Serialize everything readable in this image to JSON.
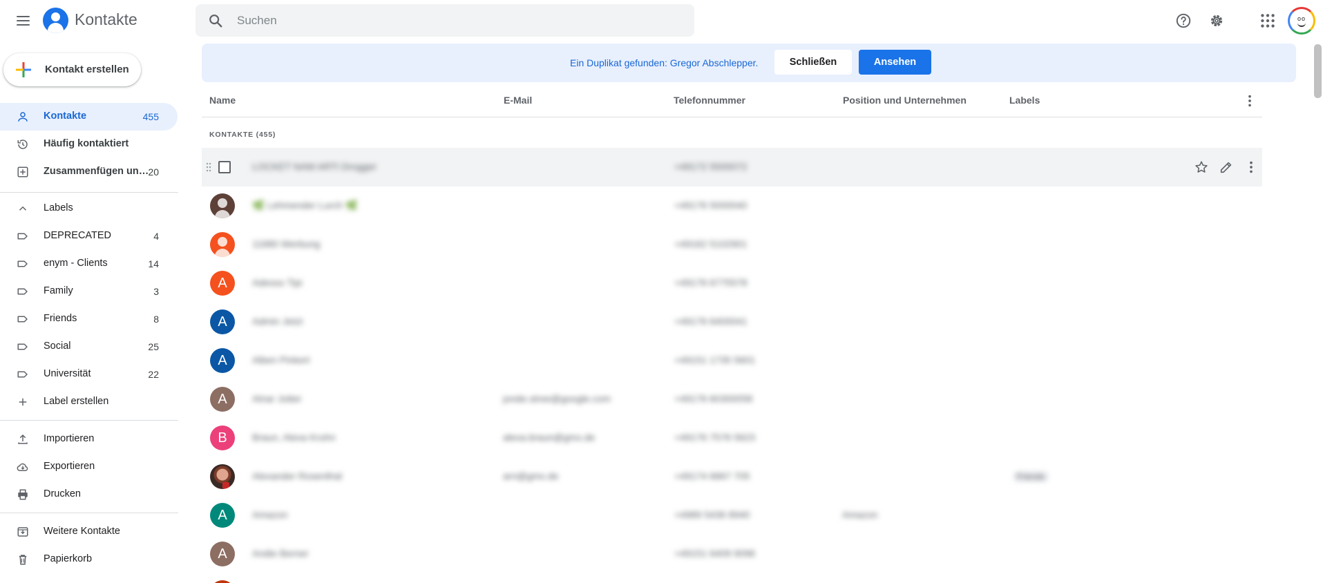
{
  "header": {
    "title": "Kontakte",
    "search_placeholder": "Suchen"
  },
  "sidebar": {
    "create_label": "Kontakt erstellen",
    "nav": [
      {
        "label": "Kontakte",
        "count": "455"
      },
      {
        "label": "Häufig kontaktiert",
        "count": ""
      },
      {
        "label": "Zusammenfügen un…",
        "count": "20"
      }
    ],
    "labels_heading": "Labels",
    "labels": [
      {
        "label": "DEPRECATED",
        "count": "4"
      },
      {
        "label": "enym - Clients",
        "count": "14"
      },
      {
        "label": "Family",
        "count": "3"
      },
      {
        "label": "Friends",
        "count": "8"
      },
      {
        "label": "Social",
        "count": "25"
      },
      {
        "label": "Universität",
        "count": "22"
      }
    ],
    "create_label_item": "Label erstellen",
    "tools": [
      "Importieren",
      "Exportieren",
      "Drucken"
    ],
    "bottom": [
      "Weitere Kontakte",
      "Papierkorb"
    ]
  },
  "banner": {
    "message": "Ein Duplikat gefunden: Gregor Abschlepper.",
    "close_label": "Schließen",
    "view_label": "Ansehen"
  },
  "table": {
    "columns": [
      "Name",
      "E-Mail",
      "Telefonnummer",
      "Position und Unternehmen",
      "Labels"
    ],
    "section_label": "KONTAKTE (455)",
    "rows": [
      {
        "avatar": "checkbox",
        "initial": "",
        "color": "",
        "name": "LOCKET NAM ARTI Drogger",
        "email": "",
        "phone": "+49172 5500072",
        "company": "",
        "label": ""
      },
      {
        "avatar": "person",
        "initial": "",
        "color": "#5d4037",
        "name": "🌿 Lehmender Lurch 🌿",
        "email": "",
        "phone": "+49176 5000040",
        "company": "",
        "label": ""
      },
      {
        "avatar": "person",
        "initial": "",
        "color": "#f4511e",
        "name": "11880 Werbung",
        "email": "",
        "phone": "+49162 5102901",
        "company": "",
        "label": ""
      },
      {
        "avatar": "letter",
        "initial": "A",
        "color": "#f4511e",
        "name": "Adesso Tipi",
        "email": "",
        "phone": "+49176 6775578",
        "company": "",
        "label": ""
      },
      {
        "avatar": "letter",
        "initial": "A",
        "color": "#0b57a6",
        "name": "Admin Jetzt",
        "email": "",
        "phone": "+49176 6400041",
        "company": "",
        "label": ""
      },
      {
        "avatar": "letter",
        "initial": "A",
        "color": "#0b57a6",
        "name": "Alben Pinkert",
        "email": "",
        "phone": "+49151 1735 5601",
        "company": "",
        "label": ""
      },
      {
        "avatar": "letter",
        "initial": "A",
        "color": "#8d6e63",
        "name": "Alnar Jotter",
        "email": "jonde.stree@google.com",
        "phone": "+49176 60300058",
        "company": "",
        "label": ""
      },
      {
        "avatar": "letter",
        "initial": "B",
        "color": "#ec407a",
        "name": "Braun, Alexa Kruhn",
        "email": "alexa.braun@gmx.de",
        "phone": "+49176 7576 5623",
        "company": "",
        "label": ""
      },
      {
        "avatar": "photo",
        "initial": "",
        "color": "#3a2a26",
        "name": "Alexander Rosenthal",
        "email": "arn@gmx.de",
        "phone": "+49174 6867 705",
        "company": "",
        "label": "Friends"
      },
      {
        "avatar": "letter",
        "initial": "A",
        "color": "#00897b",
        "name": "Amazon",
        "email": "",
        "phone": "+4989 5436 8940",
        "company": "Amazon",
        "label": ""
      },
      {
        "avatar": "letter",
        "initial": "A",
        "color": "#8d6e63",
        "name": "Andie Berner",
        "email": "",
        "phone": "+49151 6409 9096",
        "company": "",
        "label": ""
      },
      {
        "avatar": "letter",
        "initial": "",
        "color": "#bf360c",
        "name": "",
        "email": "",
        "phone": "",
        "company": "",
        "label": ""
      }
    ]
  },
  "colors": {
    "accent": "#1a73e8",
    "active_bg": "#e8f0fe",
    "active_text": "#1967d2",
    "banner_bg": "#e8f0fe"
  },
  "icons": {
    "menu": "menu-icon",
    "search": "search-icon",
    "help": "help-icon",
    "settings": "gear-icon",
    "apps": "apps-grid-icon"
  }
}
